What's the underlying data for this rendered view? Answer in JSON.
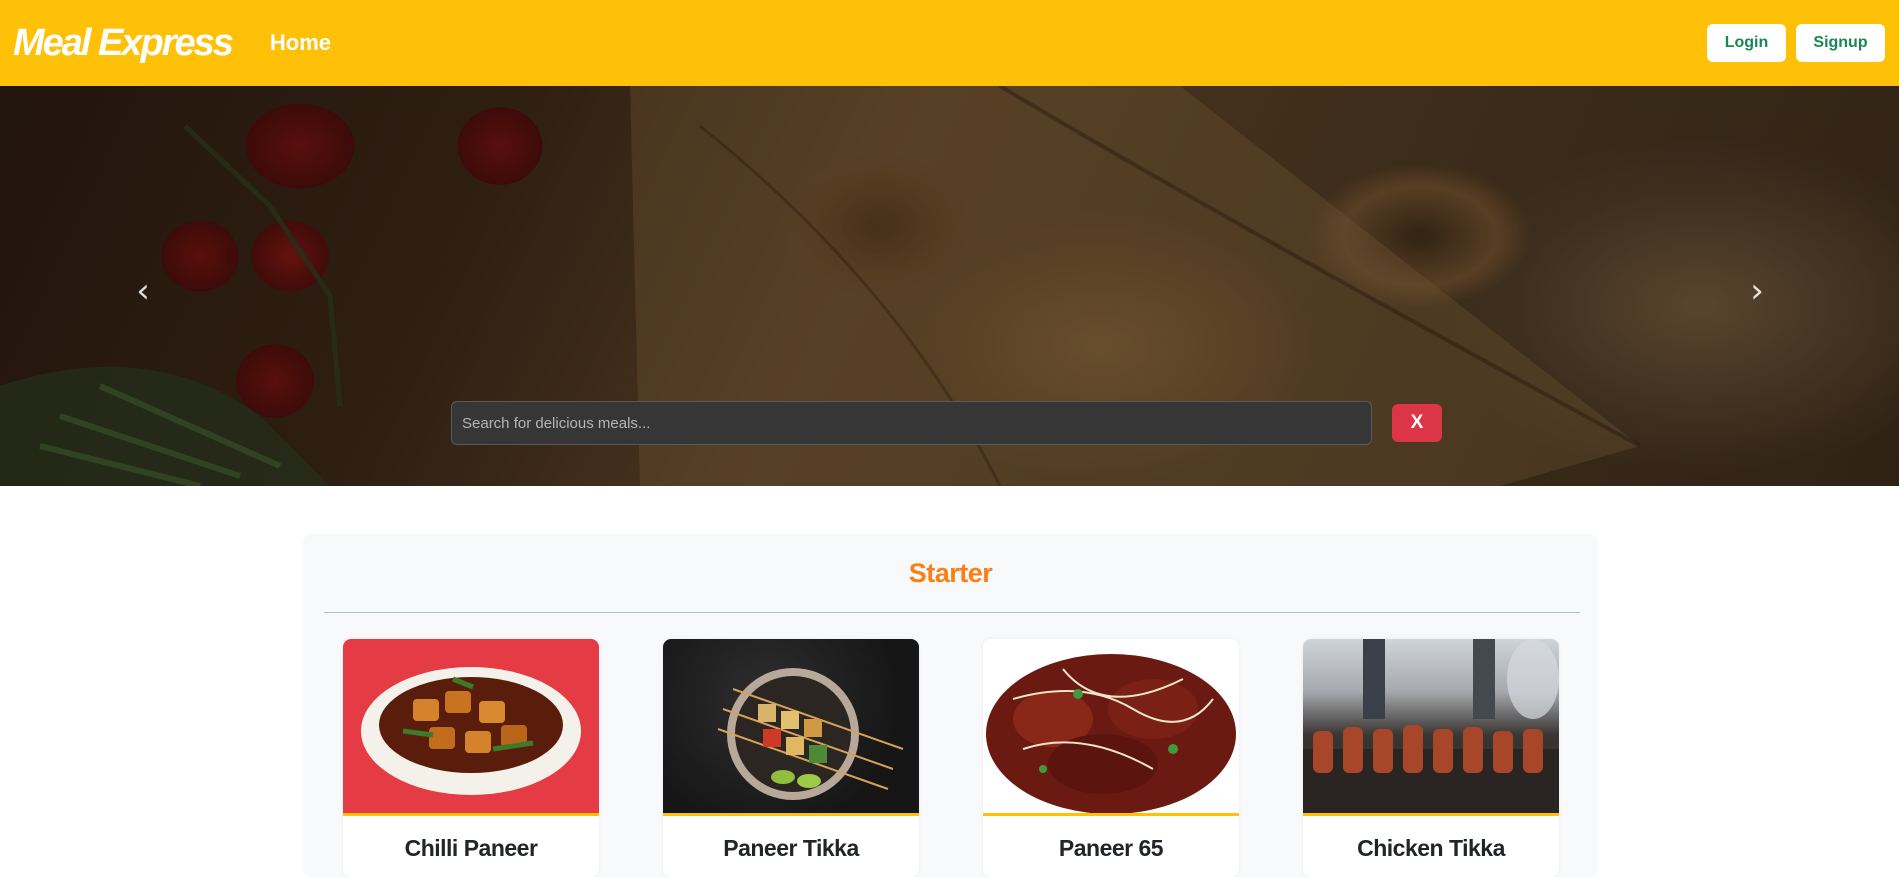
{
  "navbar": {
    "brand": "Meal Express",
    "home_label": "Home",
    "login_label": "Login",
    "signup_label": "Signup",
    "bg_color": "#ffc107"
  },
  "hero": {
    "search_placeholder": "Search for delicious meals...",
    "clear_label": "X",
    "prev_icon": "chevron-left-icon",
    "next_icon": "chevron-right-icon"
  },
  "section": {
    "title": "Starter",
    "title_color": "#fd7e14",
    "items": [
      {
        "name": "Chilli Paneer"
      },
      {
        "name": "Paneer Tikka"
      },
      {
        "name": "Paneer 65"
      },
      {
        "name": "Chicken Tikka"
      }
    ]
  }
}
